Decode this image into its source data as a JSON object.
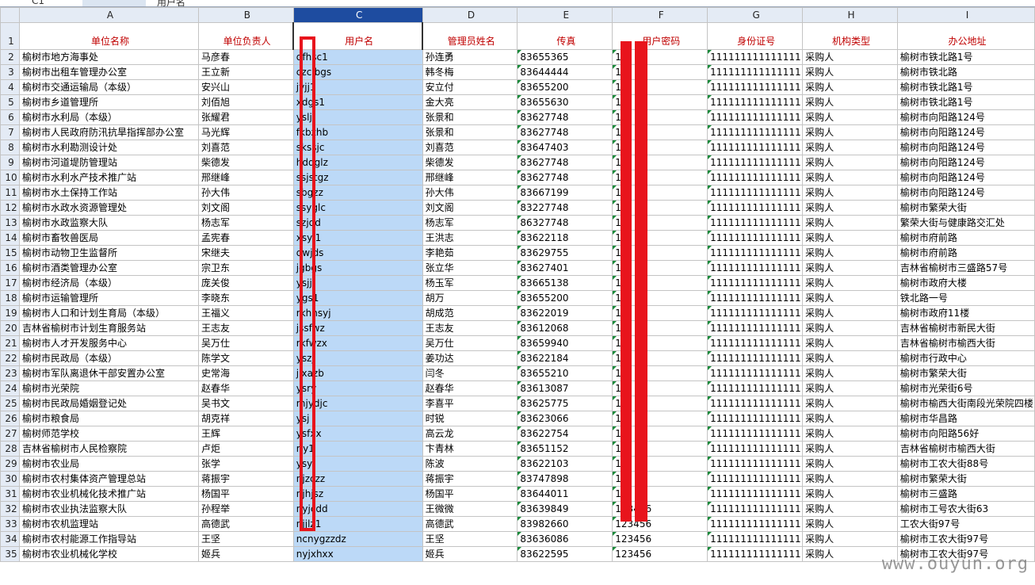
{
  "formula_bar": {
    "cell_ref": "C1",
    "fx": "fx",
    "content": "用户名"
  },
  "columns": [
    "A",
    "B",
    "C",
    "D",
    "E",
    "F",
    "G",
    "H",
    "I"
  ],
  "selected_column": "C",
  "headers": [
    "单位名称",
    "单位负责人",
    "用户名",
    "管理员姓名",
    "传真",
    "用户密码",
    "身份证号",
    "机构类型",
    "办公地址"
  ],
  "rows": [
    {
      "n": "2",
      "a": "榆树市地方海事处",
      "b": "马彦春",
      "c": "dfhsc1",
      "d": "孙连勇",
      "e": "83655365",
      "f": "1",
      "g": "111111111111111",
      "h": "采购人",
      "i": "榆树市铁北路1号"
    },
    {
      "n": "3",
      "a": "榆树市出租车管理办公室",
      "b": "王立新",
      "c": "czclbgs",
      "d": "韩冬梅",
      "e": "83644444",
      "f": "1",
      "g": "111111111111111",
      "h": "采购人",
      "i": "榆树市铁北路"
    },
    {
      "n": "4",
      "a": "榆树市交通运输局（本级）",
      "b": "安兴山",
      "c": "jyjj1",
      "d": "安立付",
      "e": "83655200",
      "f": "1",
      "g": "111111111111111",
      "h": "采购人",
      "i": "榆树市铁北路1号"
    },
    {
      "n": "5",
      "a": "榆树市乡道管理所",
      "b": "刘佰旭",
      "c": "xdgs1",
      "d": "金大亮",
      "e": "83655630",
      "f": "1",
      "g": "111111111111111",
      "h": "采购人",
      "i": "榆树市铁北路1号"
    },
    {
      "n": "6",
      "a": "榆树市水利局（本级）",
      "b": "张耀君",
      "c": "yslj",
      "d": "张景和",
      "e": "83627748",
      "f": "1",
      "g": "111111111111111",
      "h": "采购人",
      "i": "榆树市向阳路124号"
    },
    {
      "n": "7",
      "a": "榆树市人民政府防汛抗旱指挥部办公室",
      "b": "马光辉",
      "c": "fkbzhb",
      "d": "张景和",
      "e": "83627748",
      "f": "1",
      "g": "111111111111111",
      "h": "采购人",
      "i": "榆树市向阳路124号"
    },
    {
      "n": "8",
      "a": "榆树市水利勘测设计处",
      "b": "刘喜范",
      "c": "skssjc",
      "d": "刘喜范",
      "e": "83647403",
      "f": "1",
      "g": "111111111111111",
      "h": "采购人",
      "i": "榆树市向阳路124号"
    },
    {
      "n": "9",
      "a": "榆树市河道堤防管理站",
      "b": "柴德发",
      "c": "hddglz",
      "d": "柴德发",
      "e": "83627748",
      "f": "1",
      "g": "111111111111111",
      "h": "采购人",
      "i": "榆树市向阳路124号"
    },
    {
      "n": "10",
      "a": "榆树市水利水产技术推广站",
      "b": "邢继峰",
      "c": "ssjstgz",
      "d": "邢继峰",
      "e": "83627748",
      "f": "1",
      "g": "111111111111111",
      "h": "采购人",
      "i": "榆树市向阳路124号"
    },
    {
      "n": "11",
      "a": "榆树市水土保持工作站",
      "b": "孙大伟",
      "c": "sbgzz",
      "d": "孙大伟",
      "e": "83667199",
      "f": "1",
      "g": "111111111111111",
      "h": "采购人",
      "i": "榆树市向阳路124号"
    },
    {
      "n": "12",
      "a": "榆树市水政水资源管理处",
      "b": "刘文阁",
      "c": "ssyglc",
      "d": "刘文阁",
      "e": "83227748",
      "f": "1",
      "g": "111111111111111",
      "h": "采购人",
      "i": "榆树市繁荣大街"
    },
    {
      "n": "13",
      "a": "榆树市水政监察大队",
      "b": "杨志军",
      "c": "szjdd",
      "d": "杨志军",
      "e": "86327748",
      "f": "1",
      "g": "111111111111111",
      "h": "采购人",
      "i": "繁荣大街与健康路交汇处"
    },
    {
      "n": "14",
      "a": "榆树市畜牧兽医局",
      "b": "孟宪春",
      "c": "xsyj1",
      "d": "王洪志",
      "e": "83622118",
      "f": "1",
      "g": "111111111111111",
      "h": "采购人",
      "i": "榆树市府前路"
    },
    {
      "n": "15",
      "a": "榆树市动物卫生监督所",
      "b": "宋继夫",
      "c": "dwjds",
      "d": "李艳茹",
      "e": "83629755",
      "f": "1",
      "g": "111111111111111",
      "h": "采购人",
      "i": "榆树市府前路"
    },
    {
      "n": "16",
      "a": "榆树市酒类管理办公室",
      "b": "宗卫东",
      "c": "jgbgs",
      "d": "张立华",
      "e": "83627401",
      "f": "1",
      "g": "111111111111111",
      "h": "采购人",
      "i": "吉林省榆树市三盛路57号"
    },
    {
      "n": "17",
      "a": "榆树市经济局（本级）",
      "b": "庞关俊",
      "c": "ysjj",
      "d": "杨玉军",
      "e": "83665138",
      "f": "1",
      "g": "111111111111111",
      "h": "采购人",
      "i": "榆树市政府大楼"
    },
    {
      "n": "18",
      "a": "榆树市运输管理所",
      "b": "李晓东",
      "c": "ygs1",
      "d": "胡万",
      "e": "83655200",
      "f": "1",
      "g": "111111111111111",
      "h": "采购人",
      "i": "铁北路一号"
    },
    {
      "n": "19",
      "a": "榆树市人口和计划生育局（本级）",
      "b": "王福义",
      "c": "rkhhsyj",
      "d": "胡成范",
      "e": "83622019",
      "f": "1",
      "g": "111111111111111",
      "h": "采购人",
      "i": "榆树市政府11楼"
    },
    {
      "n": "20",
      "a": "吉林省榆树市计划生育服务站",
      "b": "王志友",
      "c": "jssfwz",
      "d": "王志友",
      "e": "83612068",
      "f": "1",
      "g": "111111111111111",
      "h": "采购人",
      "i": "吉林省榆树市新民大街"
    },
    {
      "n": "21",
      "a": "榆树市人才开发服务中心",
      "b": "吴万仕",
      "c": "rkfwzx",
      "d": "吴万仕",
      "e": "83659940",
      "f": "1",
      "g": "111111111111111",
      "h": "采购人",
      "i": "吉林省榆树市榆西大街"
    },
    {
      "n": "22",
      "a": "榆树市民政局（本级）",
      "b": "陈学文",
      "c": "yszj",
      "d": "姜功达",
      "e": "83622184",
      "f": "1",
      "g": "111111111111111",
      "h": "采购人",
      "i": "榆树市行政中心"
    },
    {
      "n": "23",
      "a": "榆树市军队离退休干部安置办公室",
      "b": "史常海",
      "c": "jlxazb",
      "d": "闫冬",
      "e": "83655210",
      "f": "1",
      "g": "111111111111111",
      "h": "采购人",
      "i": "榆树市繁荣大街"
    },
    {
      "n": "24",
      "a": "榆树市光荣院",
      "b": "赵春华",
      "c": "ysry",
      "d": "赵春华",
      "e": "83613087",
      "f": "1",
      "g": "111111111111111",
      "h": "采购人",
      "i": "榆树市光荣街6号"
    },
    {
      "n": "25",
      "a": "榆树市民政局婚姻登记处",
      "b": "吴书文",
      "c": "mjydjc",
      "d": "李喜平",
      "e": "83625775",
      "f": "1",
      "g": "111111111111111",
      "h": "采购人",
      "i": "榆树市榆西大街南段光荣院四楼"
    },
    {
      "n": "26",
      "a": "榆树市粮食局",
      "b": "胡克祥",
      "c": "ysj",
      "d": "时锐",
      "e": "83623066",
      "f": "1",
      "g": "111111111111111",
      "h": "采购人",
      "i": "榆树市华昌路"
    },
    {
      "n": "27",
      "a": "榆树师范学校",
      "b": "王辉",
      "c": "ysfxx",
      "d": "高云龙",
      "e": "83622754",
      "f": "1",
      "g": "111111111111111",
      "h": "采购人",
      "i": "榆树市向阳路56好"
    },
    {
      "n": "28",
      "a": "吉林省榆树市人民检察院",
      "b": "卢炬",
      "c": "rjy1",
      "d": "卞青林",
      "e": "83651152",
      "f": "1",
      "g": "111111111111111",
      "h": "采购人",
      "i": "吉林省榆树市榆西大街"
    },
    {
      "n": "29",
      "a": "榆树市农业局",
      "b": "张学",
      "c": "ysyj",
      "d": "陈波",
      "e": "83622103",
      "f": "1",
      "g": "111111111111111",
      "h": "采购人",
      "i": "榆树市工农大街88号"
    },
    {
      "n": "30",
      "a": "榆树市农村集体资产管理总站",
      "b": "蒋振宇",
      "c": "njzczz",
      "d": "蒋振宇",
      "e": "83747898",
      "f": "1",
      "g": "111111111111111",
      "h": "采购人",
      "i": "榆树市繁荣大街"
    },
    {
      "n": "31",
      "a": "榆树市农业机械化技术推广站",
      "b": "杨国平",
      "c": "njhjsz",
      "d": "杨国平",
      "e": "83644011",
      "f": "1",
      "g": "111111111111111",
      "h": "采购人",
      "i": "榆树市三盛路"
    },
    {
      "n": "32",
      "a": "榆树市农业执法监察大队",
      "b": "孙程举",
      "c": "nyjcdd",
      "d": "王微微",
      "e": "83639849",
      "f": "123456",
      "g": "111111111111111",
      "h": "采购人",
      "i": "榆树市工号农大街63"
    },
    {
      "n": "33",
      "a": "榆树市农机监理站",
      "b": "高德武",
      "c": "njjlz1",
      "d": "高德武",
      "e": "83982660",
      "f": "123456",
      "g": "111111111111111",
      "h": "采购人",
      "i": "工农大街97号"
    },
    {
      "n": "34",
      "a": "榆树市农村能源工作指导站",
      "b": "王坚",
      "c": "ncnygzzdz",
      "d": "王坚",
      "e": "83636086",
      "f": "123456",
      "g": "111111111111111",
      "h": "采购人",
      "i": "榆树市工农大街97号"
    },
    {
      "n": "35",
      "a": "榆树市农业机械化学校",
      "b": "姬兵",
      "c": "nyjxhxx",
      "d": "姬兵",
      "e": "83622595",
      "f": "123456",
      "g": "111111111111111",
      "h": "采购人",
      "i": "榆树市工农大街97号"
    }
  ],
  "watermark": "www.ouyun.org"
}
